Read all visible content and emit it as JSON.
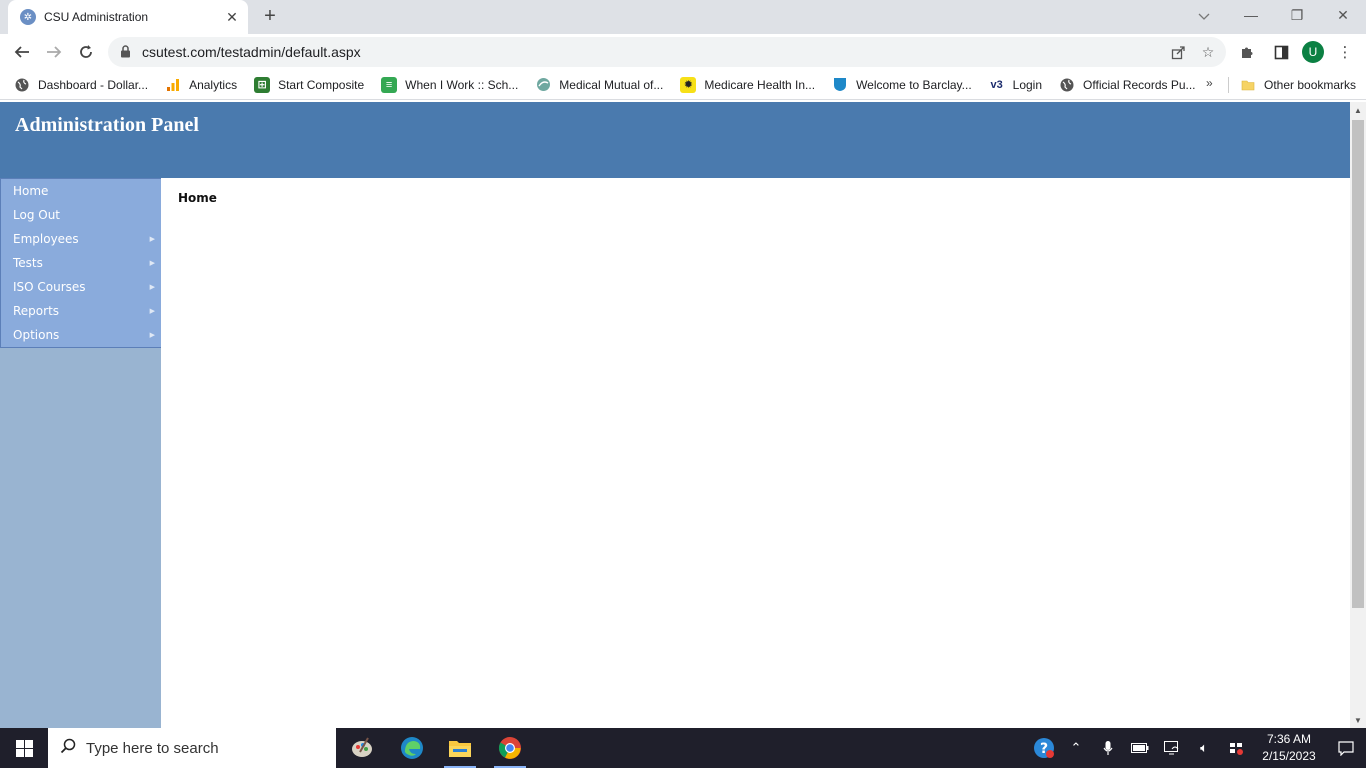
{
  "browser": {
    "tab_title": "CSU Administration",
    "url": "csutest.com/testadmin/default.aspx",
    "profile_initial": "U",
    "bookmarks": [
      {
        "label": "Dashboard - Dollar...",
        "icon": "globe-icon"
      },
      {
        "label": "Analytics",
        "icon": "analytics-icon"
      },
      {
        "label": "Start Composite",
        "icon": "composite-icon"
      },
      {
        "label": "When I Work :: Sch...",
        "icon": "document-icon"
      },
      {
        "label": "Medical Mutual of...",
        "icon": "medical-icon"
      },
      {
        "label": "Medicare Health In...",
        "icon": "sun-icon"
      },
      {
        "label": "Welcome to Barclay...",
        "icon": "barclays-icon"
      },
      {
        "label": "Login",
        "icon": "v3-icon",
        "icon_text": "v3"
      },
      {
        "label": "Official Records Pu...",
        "icon": "globe-icon"
      }
    ],
    "bookmarks_overflow": "»",
    "other_bookmarks": "Other bookmarks"
  },
  "page": {
    "header_title": "Administration Panel",
    "menu": [
      {
        "label": "Home",
        "has_submenu": false
      },
      {
        "label": "Log Out",
        "has_submenu": false
      },
      {
        "label": "Employees",
        "has_submenu": true
      },
      {
        "label": "Tests",
        "has_submenu": true
      },
      {
        "label": "ISO Courses",
        "has_submenu": true
      },
      {
        "label": "Reports",
        "has_submenu": true
      },
      {
        "label": "Options",
        "has_submenu": true
      }
    ],
    "breadcrumb": "Home"
  },
  "taskbar": {
    "search_placeholder": "Type here to search",
    "time": "7:36 AM",
    "date": "2/15/2023"
  },
  "colors": {
    "header_bg": "#4a7aae",
    "menu_bg": "#8aabdc",
    "sidebar_bg": "#99b4d1"
  }
}
